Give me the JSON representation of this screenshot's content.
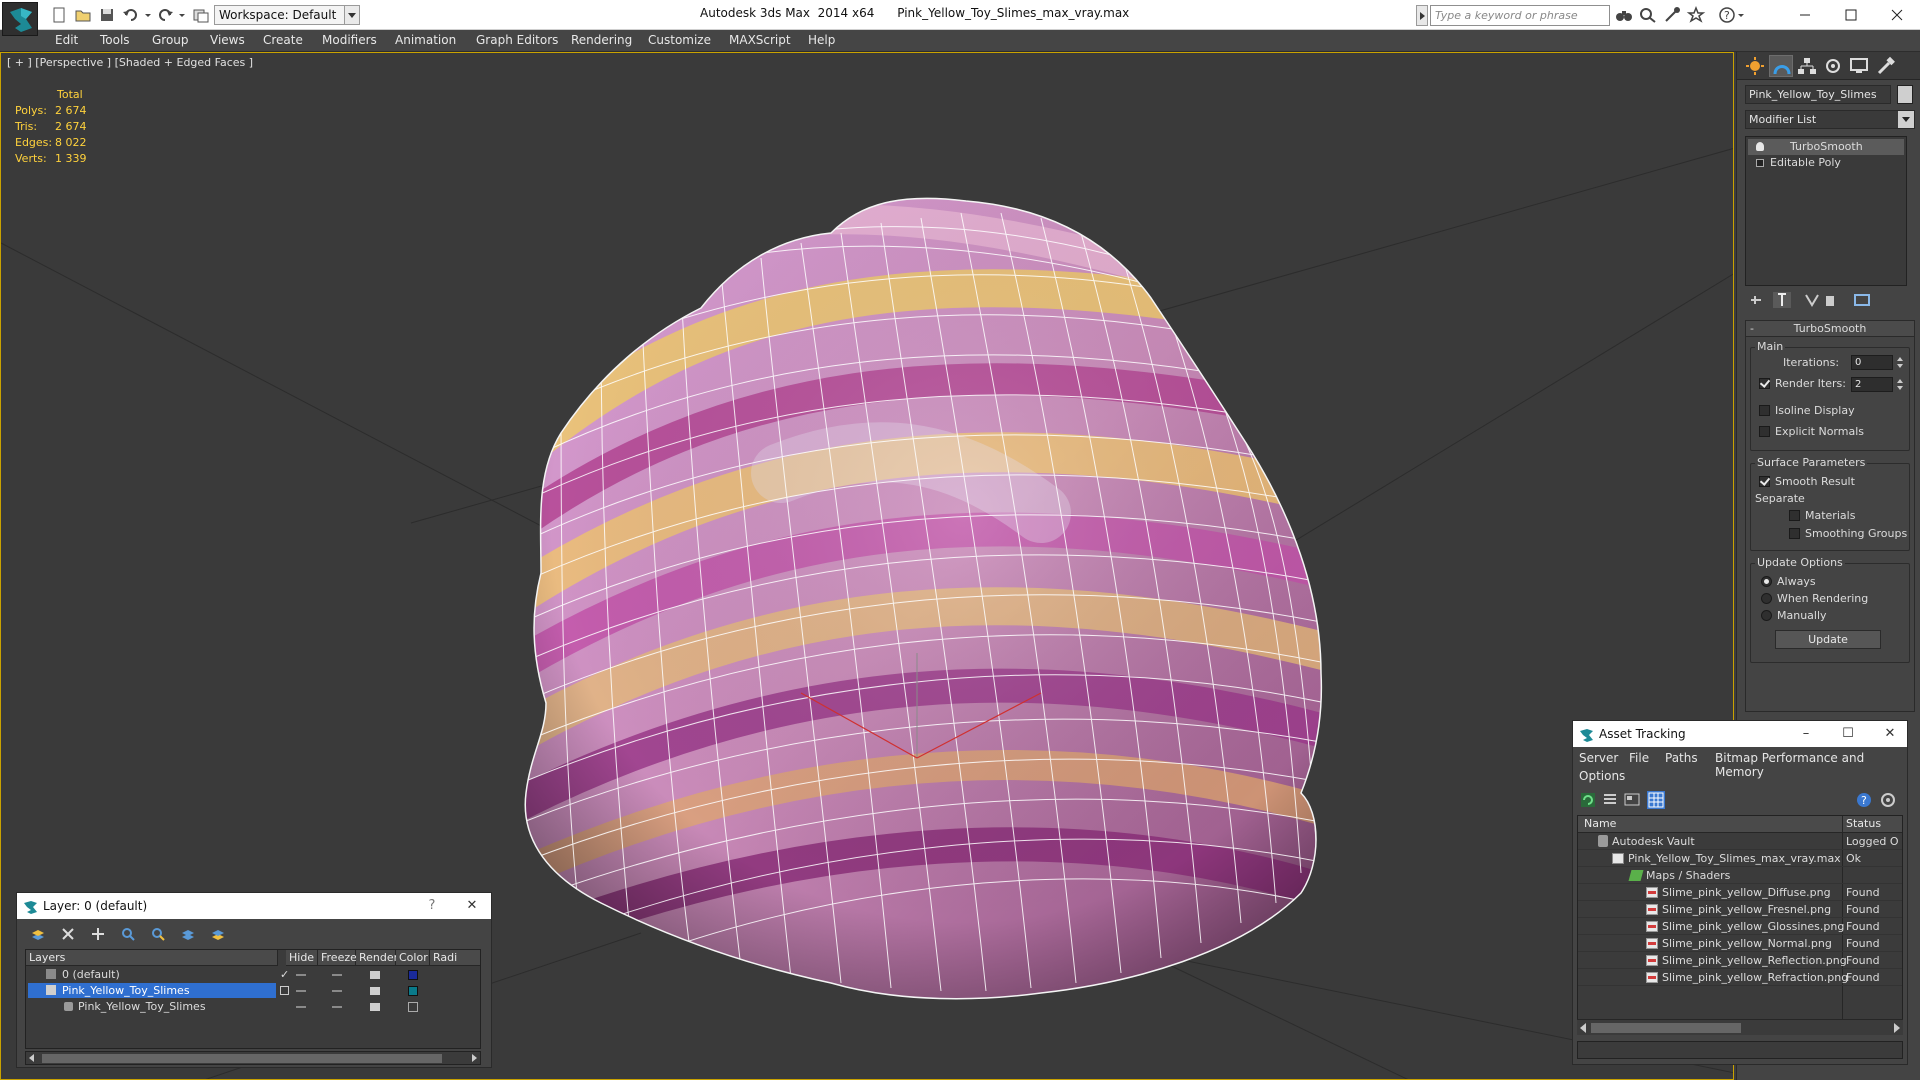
{
  "titlebar": {
    "workspace": "Workspace: Default",
    "app_title": "Autodesk 3ds Max  2014 x64",
    "file_name": "Pink_Yellow_Toy_Slimes_max_vray.max",
    "search_placeholder": "Type a keyword or phrase"
  },
  "menu": [
    "Edit",
    "Tools",
    "Group",
    "Views",
    "Create",
    "Modifiers",
    "Animation",
    "Graph Editors",
    "Rendering",
    "Customize",
    "MAXScript",
    "Help"
  ],
  "viewport": {
    "label": "[ + ] [Perspective ] [Shaded + Edged Faces ]",
    "stats": {
      "total_label": "Total",
      "rows": [
        {
          "label": "Polys:",
          "value": "2 674"
        },
        {
          "label": "Tris:",
          "value": "2 674"
        },
        {
          "label": "Edges:",
          "value": "8 022"
        },
        {
          "label": "Verts:",
          "value": "1 339"
        }
      ]
    },
    "colors": {
      "border": "#c9a200",
      "stats": "#ffd23c",
      "background": "#3a3a3a"
    }
  },
  "command_panel": {
    "object_name": "Pink_Yellow_Toy_Slimes",
    "modifier_list": "Modifier List",
    "stack": [
      "TurboSmooth",
      "Editable Poly"
    ],
    "turbosmooth": {
      "title": "TurboSmooth",
      "main_group": "Main",
      "iterations_label": "Iterations:",
      "iterations": "0",
      "render_iters_label": "Render Iters:",
      "render_iters": "2",
      "isoline_display": "Isoline Display",
      "explicit_normals": "Explicit Normals",
      "surface_group": "Surface Parameters",
      "smooth_result": "Smooth Result",
      "separate_label": "Separate",
      "materials": "Materials",
      "smoothing_groups": "Smoothing Groups",
      "update_group": "Update Options",
      "always": "Always",
      "when_rendering": "When Rendering",
      "manually": "Manually",
      "update_button": "Update"
    }
  },
  "asset_tracking": {
    "title": "Asset Tracking",
    "menu": [
      "Server",
      "File",
      "Paths",
      "Bitmap Performance and Memory",
      "Options"
    ],
    "columns": [
      "Name",
      "Status"
    ],
    "rows": [
      {
        "name": "Autodesk Vault",
        "status": "Logged O"
      },
      {
        "name": "Pink_Yellow_Toy_Slimes_max_vray.max",
        "status": "Ok"
      },
      {
        "name": "Maps / Shaders",
        "status": ""
      },
      {
        "name": "Slime_pink_yellow_Diffuse.png",
        "status": "Found"
      },
      {
        "name": "Slime_pink_yellow_Fresnel.png",
        "status": "Found"
      },
      {
        "name": "Slime_pink_yellow_Glossines.png",
        "status": "Found"
      },
      {
        "name": "Slime_pink_yellow_Normal.png",
        "status": "Found"
      },
      {
        "name": "Slime_pink_yellow_Reflection.png",
        "status": "Found"
      },
      {
        "name": "Slime_pink_yellow_Refraction.png",
        "status": "Found"
      }
    ]
  },
  "layer_explorer": {
    "title": "Layer: 0 (default)",
    "help": "?",
    "columns": [
      "Layers",
      "Hide",
      "Freeze",
      "Render",
      "Color",
      "Radi"
    ],
    "rows": [
      {
        "name": "0 (default)",
        "color": "#1a2a9a"
      },
      {
        "name": "Pink_Yellow_Toy_Slimes",
        "color": "#0a7a8a"
      },
      {
        "name": "Pink_Yellow_Toy_Slimes",
        "color": "#3a3a3a"
      }
    ]
  }
}
